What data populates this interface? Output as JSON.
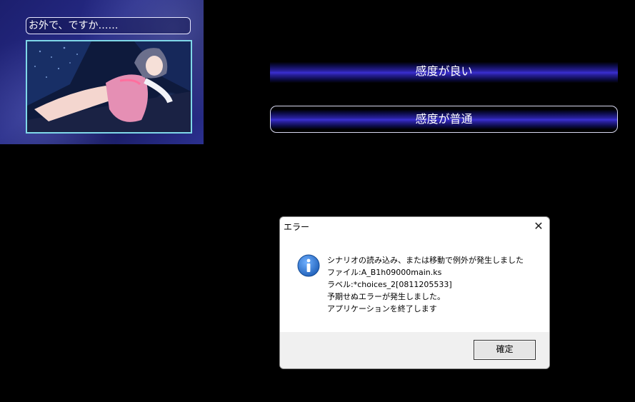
{
  "game": {
    "preview": {
      "title": "お外で、ですか……"
    },
    "choices": [
      {
        "label": "感度が良い"
      },
      {
        "label": "感度が普通"
      }
    ]
  },
  "dialog": {
    "title": "エラー",
    "close_glyph": "✕",
    "icon": "info-icon",
    "message_lines": [
      "シナリオの読み込み、または移動で例外が発生しました",
      "ファイル:A_B1h09000main.ks",
      "ラベル:*choices_2[0811205533]",
      "予期せぬエラーが発生しました。",
      "アプリケーションを終了します"
    ],
    "ok_label": "確定"
  },
  "colors": {
    "background": "#000000",
    "panel_navy": "#1c1f6e",
    "choice_glow": "#3a2fd0",
    "thumbnail_border": "#7fd8e8",
    "info_blue": "#1f5fb8"
  }
}
